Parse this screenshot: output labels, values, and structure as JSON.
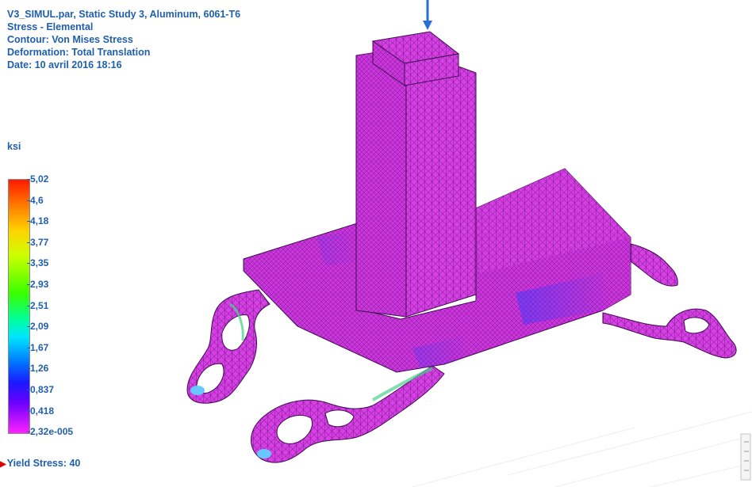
{
  "header": {
    "line1": "V3_SIMUL.par, Static Study 3, Aluminum, 6061-T6",
    "line2": "Stress - Elemental",
    "line3": "Contour: Von Mises Stress",
    "line4": "Deformation: Total Translation",
    "line5": "Date: 10 avril 2016  18:16"
  },
  "legend": {
    "units": "ksi",
    "ticks": [
      "5,02",
      "4,6",
      "4,18",
      "3,77",
      "3,35",
      "2,93",
      "2,51",
      "2,09",
      "1,67",
      "1,26",
      "0,837",
      "0,418",
      "2,32e-005"
    ],
    "yield_marker": "▶",
    "yield_text": "Yield Stress: 40"
  },
  "colors": {
    "text": "#1f5fae",
    "mesh_magenta": "#d43ae0",
    "mesh_dark": "#7a1a8a",
    "low_stress": "#ff22ff",
    "mid_stress": "#1a1aff",
    "high_stress": "#ff1a00",
    "load_arrow": "#2a6fd6"
  }
}
